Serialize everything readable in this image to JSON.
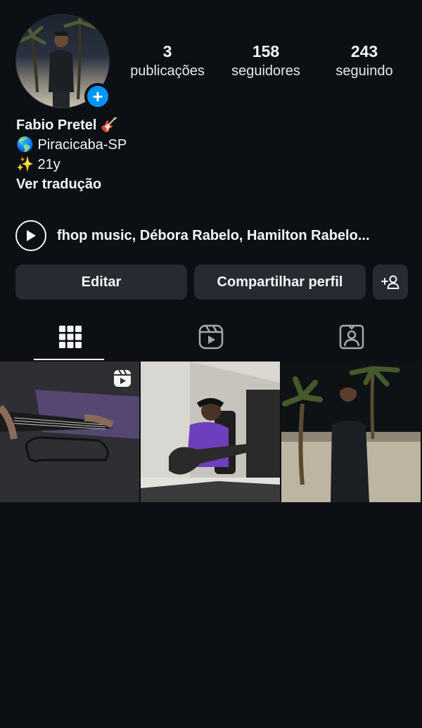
{
  "profile": {
    "stats": [
      {
        "value": "3",
        "label": "publicações"
      },
      {
        "value": "158",
        "label": "seguidores"
      },
      {
        "value": "243",
        "label": "seguindo"
      }
    ],
    "bio": {
      "name": "Fabio Pretel 🎸",
      "location": "🌎 Piracicaba-SP",
      "age": "✨ 21y",
      "translate": "Ver tradução"
    },
    "music_line": "fhop music, Débora Rabelo, Hamilton Rabelo..."
  },
  "buttons": {
    "edit": "Editar",
    "share": "Compartilhar perfil"
  },
  "tabs": [
    {
      "icon": "grid-icon",
      "active": true
    },
    {
      "icon": "reels-icon",
      "active": false
    },
    {
      "icon": "tagged-icon",
      "active": false
    }
  ],
  "posts": [
    {
      "type": "reel",
      "description": "guitar"
    },
    {
      "type": "photo",
      "description": "guitar-player"
    },
    {
      "type": "photo",
      "description": "beach"
    }
  ],
  "colors": {
    "background": "#0c1014",
    "button": "#262a31",
    "accent": "#0095f6"
  }
}
